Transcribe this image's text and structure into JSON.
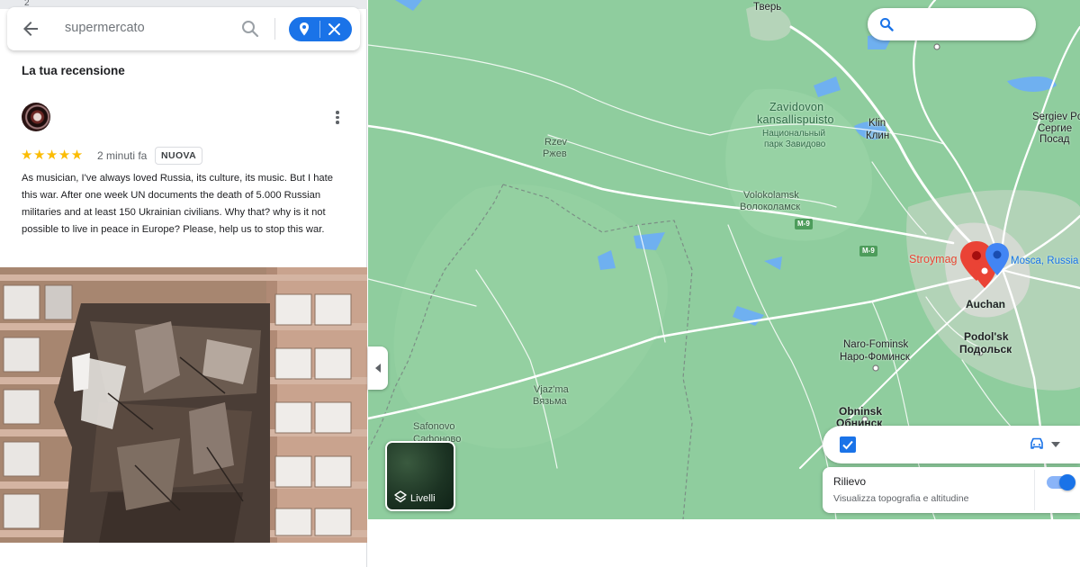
{
  "top_strip": {
    "number": "2"
  },
  "search": {
    "query": "supermercato",
    "back_icon": "arrow-back-icon",
    "search_icon": "search-icon",
    "location_icon": "location-pin-icon",
    "close_icon": "close-icon"
  },
  "review": {
    "section_title": "La tua recensione",
    "rating": 5,
    "stars_display": "★★★★★",
    "time": "2 minuti fa",
    "badge": "NUOVA",
    "text": "As musician, I've always loved Russia, its culture, its music. But I hate this war. After one week UN documents the death of 5.000 Russian militaries and at least 150 Ukrainian civilians. Why that? why is it not possible to live in peace in Europe? Please, help us to stop this war."
  },
  "map": {
    "labels": {
      "tver": "Тверь",
      "zavidovo_1": "Zavidovon",
      "zavidovo_2": "kansallispuisto",
      "zavidovo_3": "Национальный",
      "zavidovo_4": "парк Завидово",
      "klin_lat": "Klin",
      "klin_cyr": "Клин",
      "sergiev_1": "Sergiev Po",
      "sergiev_2": "Сергие",
      "sergiev_3": "Посад",
      "rzev_lat": "Rzev",
      "rzev_cyr": "Ржев",
      "volok_lat": "Volokolamsk",
      "volok_cyr": "Волоколамск",
      "stroymag": "Stroymag",
      "mosca": "Mosca, Russia",
      "auchan": "Auchan",
      "naro_lat": "Naro-Fominsk",
      "naro_cyr": "Наро-Фоминск",
      "podolsk_lat": "Podol'sk",
      "podolsk_cyr": "Подольск",
      "vyazma_lat": "Vjaz'ma",
      "vyazma_cyr": "Вязьма",
      "safonovo_lat": "Safonovo",
      "safonovo_cyr": "Сафоново",
      "obninsk_lat": "Obninsk",
      "obninsk_cyr": "Обнинск",
      "shield_1": "M-9",
      "shield_2": "M-9"
    },
    "colors": {
      "land": "#8fcd9e",
      "road": "#ffffff",
      "water": "#6fb0f0",
      "pin_red": "#ea4335",
      "pin_blue": "#4285f4"
    }
  },
  "controls": {
    "layers_label": "Livelli",
    "layers_icon": "layers-icon",
    "collapse_icon": "chevron-left-icon",
    "map_search_icon": "search-icon",
    "checkbox_checked": true,
    "travel_mode_icon": "car-icon",
    "relief": {
      "title": "Rilievo",
      "subtitle": "Visualizza topografia e altitudine",
      "enabled": true
    }
  }
}
